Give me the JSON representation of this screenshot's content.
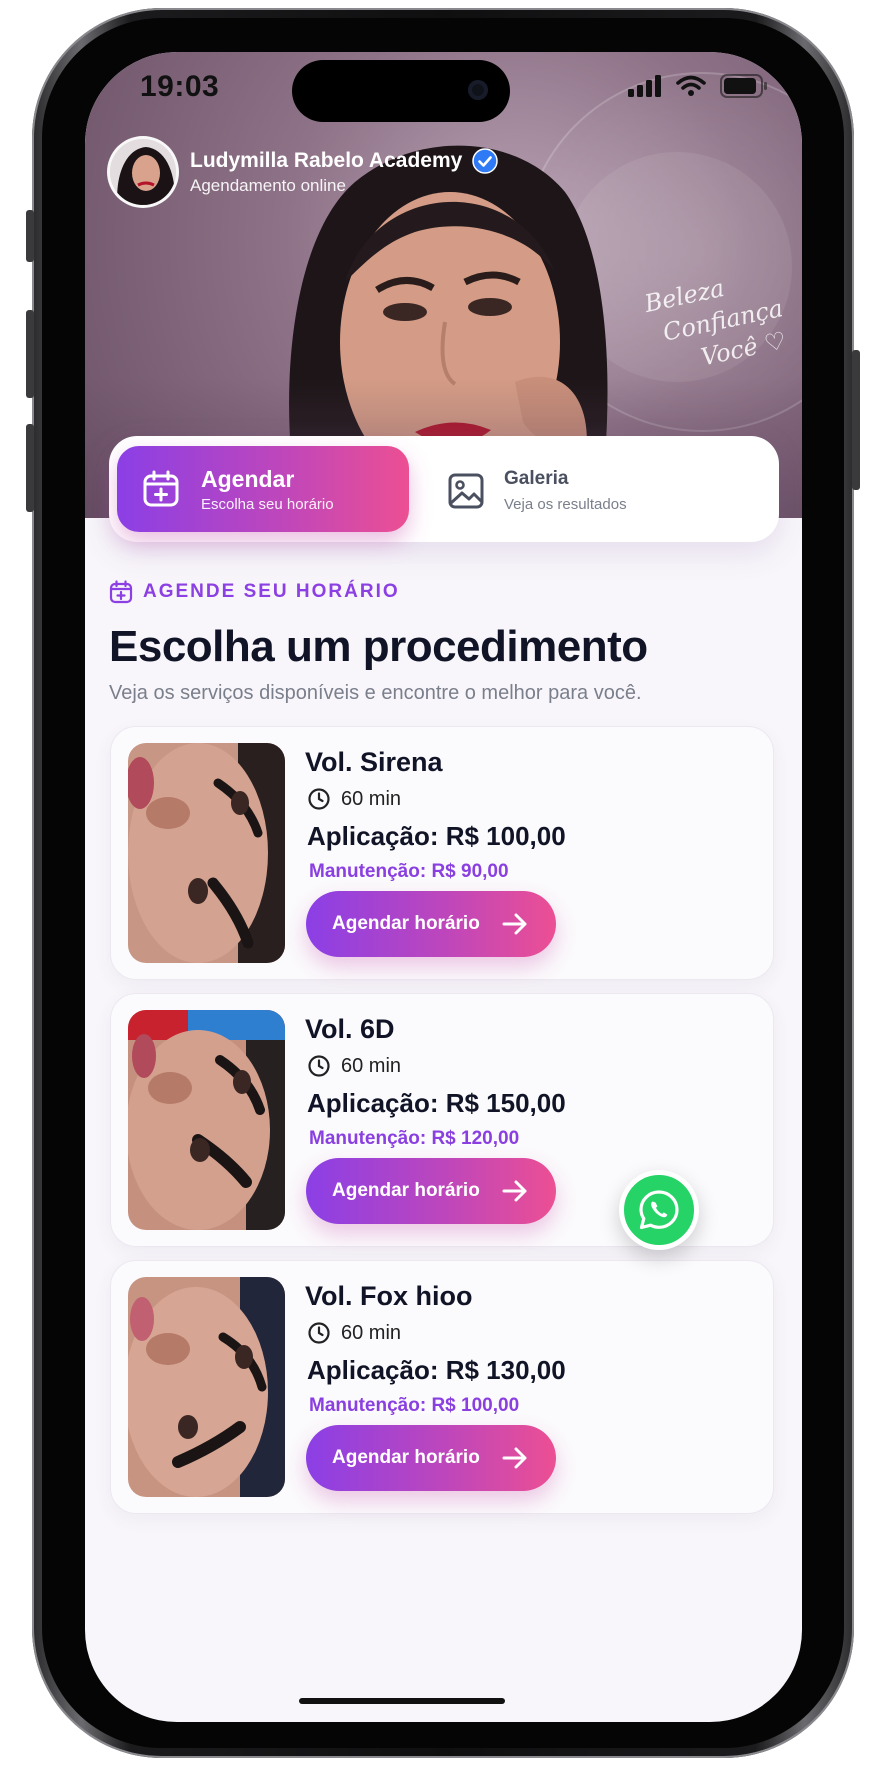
{
  "status_bar": {
    "time": "19:03"
  },
  "profile": {
    "name": "Ludymilla Rabelo Academy",
    "subtitle": "Agendamento online"
  },
  "hero": {
    "script_lines": [
      "Beleza",
      "Confiança",
      "Você ♡"
    ]
  },
  "tabs": [
    {
      "title": "Agendar",
      "subtitle": "Escolha seu horário",
      "icon": "calendar-plus-icon",
      "active": true
    },
    {
      "title": "Galeria",
      "subtitle": "Veja os resultados",
      "icon": "image-icon",
      "active": false
    }
  ],
  "section": {
    "eyebrow": "AGENDE SEU HORÁRIO",
    "title": "Escolha um procedimento",
    "description": "Veja os serviços disponíveis e encontre o melhor para você."
  },
  "services": [
    {
      "name": "Vol. Sirena",
      "duration": "60 min",
      "price": "Aplicação: R$ 100,00",
      "maintenance": "Manutenção: R$ 90,00",
      "button": "Agendar horário"
    },
    {
      "name": "Vol. 6D",
      "duration": "60 min",
      "price": "Aplicação: R$ 150,00",
      "maintenance": "Manutenção: R$ 120,00",
      "button": "Agendar horário"
    },
    {
      "name": "Vol. Fox hioo",
      "duration": "60 min",
      "price": "Aplicação: R$ 130,00",
      "maintenance": "Manutenção: R$ 100,00",
      "button": "Agendar horário"
    }
  ],
  "colors": {
    "accent_purple": "#8b3fe6",
    "accent_pink": "#ec4f93",
    "whatsapp_green": "#25d366"
  }
}
